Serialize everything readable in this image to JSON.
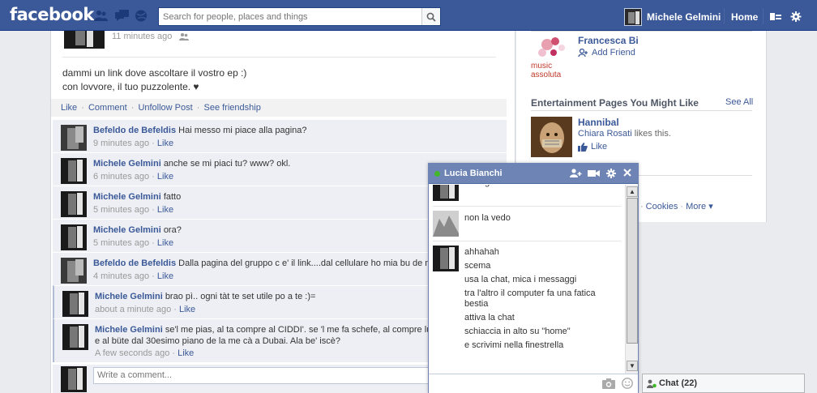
{
  "topbar": {
    "logo": "facebook",
    "search_placeholder": "Search for people, places and things",
    "user_name": "Michele Gelmini",
    "home_label": "Home"
  },
  "post": {
    "time": "11 minutes ago",
    "message_lines": [
      "dammi un link dove ascoltare il vostro ep :)",
      "con lovvore, il tuo puzzolente. ♥"
    ],
    "actions": [
      "Like",
      "Comment",
      "Unfollow Post",
      "See friendship"
    ]
  },
  "comments": [
    {
      "name": "Befeldo de Befeldis",
      "text": "Hai messo mi piace alla pagina?",
      "time": "9 minutes ago",
      "like": "Like"
    },
    {
      "name": "Michele Gelmini",
      "text": "anche se mi piaci tu? www? okl.",
      "time": "6 minutes ago",
      "like": "Like"
    },
    {
      "name": "Michele Gelmini",
      "text": "fatto",
      "time": "5 minutes ago",
      "like": "Like"
    },
    {
      "name": "Michele Gelmini",
      "text": "ora?",
      "time": "5 minutes ago",
      "like": "Like"
    },
    {
      "name": "Befeldo de Befeldis",
      "text": "Dalla pagina del gruppo c e' il link....dal cellulare ho mia bu de ma",
      "time": "4 minutes ago",
      "like": "Like"
    },
    {
      "name": "Michele Gelmini",
      "text": "brao pì.. ogni tàt te set utile po a te :)=",
      "time": "about a minute ago",
      "like": "Like"
    },
    {
      "name": "Michele Gelmini",
      "text": "se'l me pias, al ta compre al CIDDI'. se 'l me fa schefe, al compre lù s gà spüde sura, e al büte dal 30esimo piano de la me cà a Dubai. Ala be' iscè?",
      "time": "A few seconds ago",
      "like": "Like"
    }
  ],
  "write_comment_placeholder": "Write a comment...",
  "sidebar": {
    "friend_suggestion": {
      "name": "Francesca Bi",
      "action": "Add Friend",
      "logo_text": "music assoluta"
    },
    "pages_title": "Entertainment Pages You Might Like",
    "see_all": "See All",
    "page": {
      "name": "Hannibal",
      "liker": "Chiara Rosati",
      "likes_suffix": " likes this.",
      "like_label": "Like"
    },
    "footer": [
      "Cookies",
      "More ▾"
    ]
  },
  "chat": {
    "title": "Lucia Bianchi",
    "partial_line": "intelligenza",
    "msg_2": "non la vedo",
    "msg_3": [
      "ahhahah",
      "scema",
      "usa la chat, mica i messaggi",
      "tra l'altro il computer fa una fatica bestia",
      "attiva la chat",
      "schiaccia in alto su \"home\"",
      "e scrivimi nella finestrella"
    ]
  },
  "chatbar": {
    "label": "Chat (22)"
  },
  "colors": {
    "brand": "#3b5998",
    "comment_bg": "#edeff4",
    "chat_header": "#6d84b4",
    "online": "#42b72a"
  }
}
